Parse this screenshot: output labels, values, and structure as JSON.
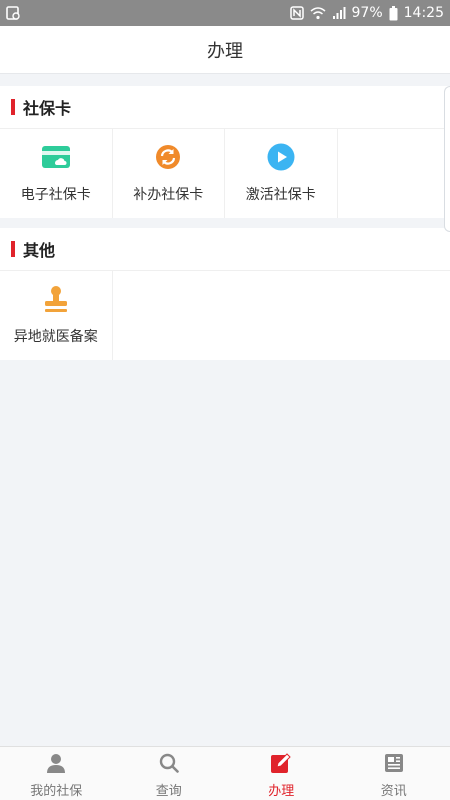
{
  "status_bar": {
    "battery": "97%",
    "time": "14:25",
    "icons": [
      "gallery-icon",
      "nfc-icon",
      "wifi-icon",
      "signal-icon",
      "battery-icon"
    ]
  },
  "header": {
    "title": "办理"
  },
  "sections": [
    {
      "title": "社保卡",
      "items": [
        {
          "label": "电子社保卡",
          "icon": "card-icon",
          "color": "#2ecc9a"
        },
        {
          "label": "补办社保卡",
          "icon": "refresh-icon",
          "color": "#f08a2a"
        },
        {
          "label": "激活社保卡",
          "icon": "play-icon",
          "color": "#3bb4f2"
        }
      ]
    },
    {
      "title": "其他",
      "items": [
        {
          "label": "异地就医备案",
          "icon": "stamp-icon",
          "color": "#f2a33a"
        }
      ]
    }
  ],
  "tabbar": {
    "tabs": [
      {
        "label": "我的社保",
        "icon": "user-icon",
        "active": false
      },
      {
        "label": "查询",
        "icon": "search-icon",
        "active": false
      },
      {
        "label": "办理",
        "icon": "edit-icon",
        "active": true
      },
      {
        "label": "资讯",
        "icon": "news-icon",
        "active": false
      }
    ],
    "active_color": "#e0232b",
    "inactive_color": "#777777"
  },
  "accent_color": "#e0232b"
}
